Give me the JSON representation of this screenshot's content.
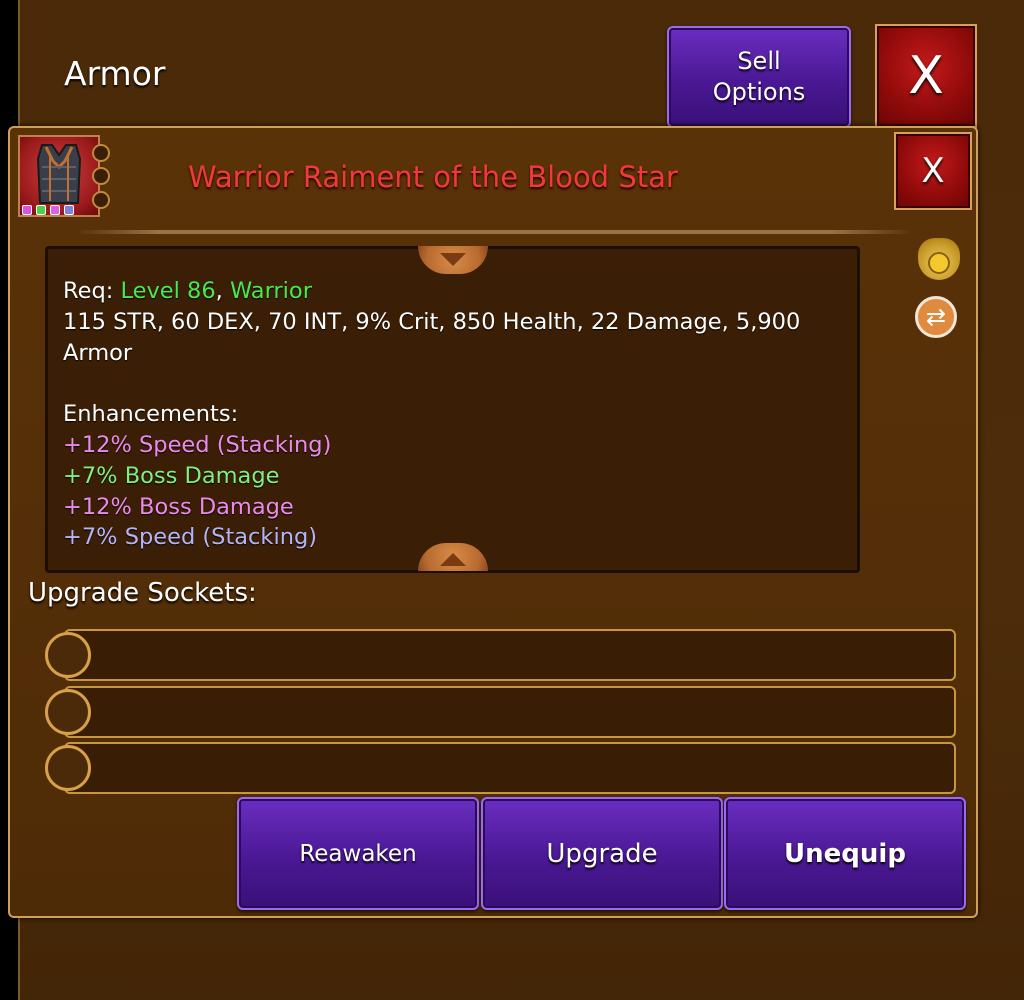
{
  "header": {
    "title": "Armor",
    "sell_label_1": "Sell",
    "sell_label_2": "Options",
    "close_glyph": "X"
  },
  "item": {
    "name": "Warrior Raiment of the Blood Star",
    "name_color": "#f03a3a",
    "icon": "armor-vest-icon",
    "close_glyph": "X",
    "gem_colors": [
      "#e050d8",
      "#4cd04c",
      "#e060e0",
      "#8080e0"
    ]
  },
  "details": {
    "req_prefix": "Req: ",
    "req_level": "Level 86",
    "req_sep": ", ",
    "req_class": "Warrior",
    "stats_line_1": "115 STR, 60 DEX, 70 INT, 9% Crit, 850 Health, 22 Damage, 5,900",
    "stats_line_2": "Armor",
    "enh_header": "Enhancements:",
    "enhancements": [
      {
        "text": "+12% Speed (Stacking)",
        "color": "#ea8aea"
      },
      {
        "text": "+7% Boss Damage",
        "color": "#80ee80"
      },
      {
        "text": "+12% Boss Damage",
        "color": "#ea8aea"
      },
      {
        "text": "+7% Speed (Stacking)",
        "color": "#b4b4f6"
      }
    ]
  },
  "side_icons": [
    "gold-bag-icon",
    "swap-icon"
  ],
  "sockets": {
    "label": "Upgrade Sockets:",
    "slots": [
      "empty",
      "empty",
      "empty"
    ]
  },
  "actions": {
    "reawaken": "Reawaken",
    "upgrade": "Upgrade",
    "unequip": "Unequip"
  },
  "colors": {
    "panel_brown": "#4c2c0a",
    "button_purple": "#4a1894",
    "close_red": "#8e0a0a",
    "req_green": "#4be84b"
  }
}
